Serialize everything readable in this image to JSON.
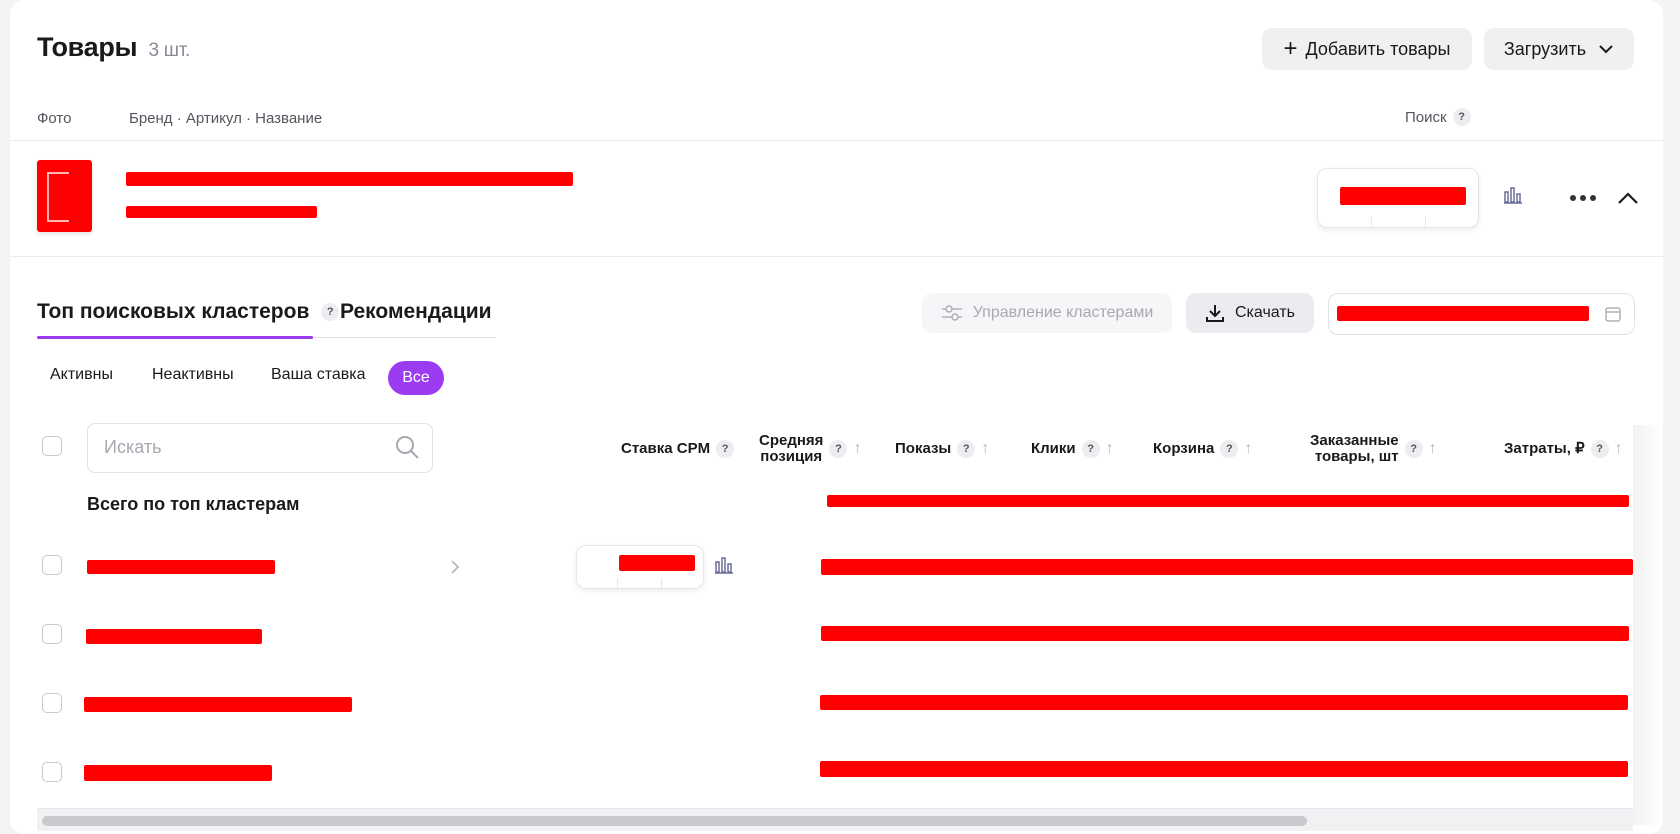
{
  "header": {
    "title": "Товары",
    "count": "3 шт.",
    "add_button": "Добавить товары",
    "upload_button": "Загрузить"
  },
  "columns": {
    "photo": "Фото",
    "brand": "Бренд · Артикул · Название",
    "search": "Поиск",
    "help": "?"
  },
  "tabs": {
    "top_clusters": "Топ поисковых кластеров",
    "recommendations": "Рекомендации"
  },
  "toolbar": {
    "manage_clusters": "Управление кластерами",
    "download": "Скачать"
  },
  "filters": {
    "active": "Активны",
    "inactive": "Неактивны",
    "your_bid": "Ваша ставка",
    "all": "Все"
  },
  "search": {
    "placeholder": "Искать"
  },
  "table": {
    "headers": {
      "cpm": "Ставка CPM",
      "avg_position": "Средняя\nпозиция",
      "impressions": "Показы",
      "clicks": "Клики",
      "cart": "Корзина",
      "ordered": "Заказанные\nтовары, шт",
      "spend": "Затраты, ₽"
    },
    "total_label": "Всего по топ кластерам"
  },
  "colors": {
    "accent": "#9b3cf2",
    "redaction": "#ff0000"
  }
}
